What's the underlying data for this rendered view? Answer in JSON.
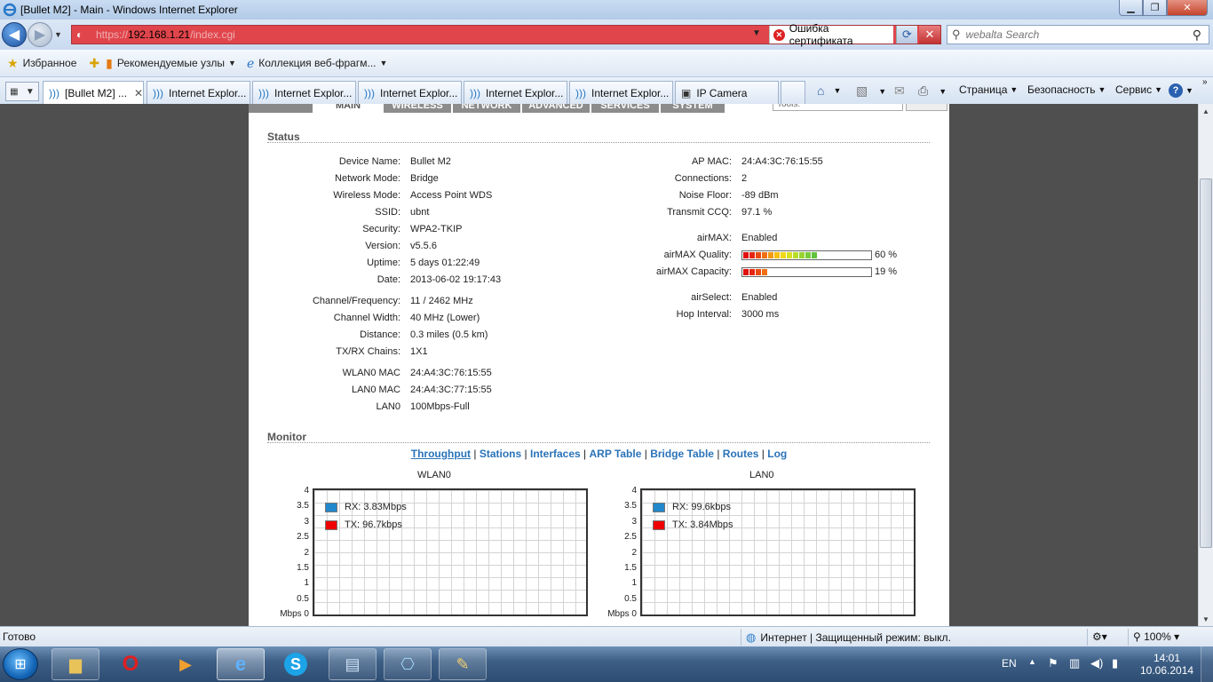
{
  "window": {
    "title": "[Bullet M2] - Main - Windows Internet Explorer"
  },
  "address": {
    "url_prefix": "https://",
    "url_host": "192.168.1.21",
    "url_path": "/index.cgi",
    "cert_error": "Ошибка сертификата"
  },
  "search": {
    "placeholder": "webalta Search"
  },
  "favorites": {
    "favorites_label": "Избранное",
    "suggested_label": "Рекомендуемые узлы",
    "gallery_label": "Коллекция веб-фрагм..."
  },
  "tabs": [
    {
      "label": "[Bullet M2] ..."
    },
    {
      "label": "Internet Explor..."
    },
    {
      "label": "Internet Explor..."
    },
    {
      "label": "Internet Explor..."
    },
    {
      "label": "Internet Explor..."
    },
    {
      "label": "Internet Explor..."
    },
    {
      "label": "IP Camera"
    }
  ],
  "commandbar": {
    "page": "Страница",
    "safety": "Безопасность",
    "tools": "Сервис"
  },
  "page": {
    "menu_tabs": [
      "MAIN",
      "WIRELESS",
      "NETWORK",
      "ADVANCED",
      "SERVICES",
      "SYSTEM"
    ],
    "tool_select": "Tools:",
    "status_title": "Status",
    "left": [
      {
        "label": "Device Name:",
        "value": "Bullet M2"
      },
      {
        "label": "Network Mode:",
        "value": "Bridge"
      },
      {
        "label": "Wireless Mode:",
        "value": "Access Point WDS"
      },
      {
        "label": "SSID:",
        "value": "ubnt"
      },
      {
        "label": "Security:",
        "value": "WPA2-TKIP"
      },
      {
        "label": "Version:",
        "value": "v5.5.6"
      },
      {
        "label": "Uptime:",
        "value": "5 days 01:22:49"
      },
      {
        "label": "Date:",
        "value": "2013-06-02 19:17:43"
      },
      {
        "label": "Channel/Frequency:",
        "value": "11 / 2462 MHz"
      },
      {
        "label": "Channel Width:",
        "value": "40 MHz (Lower)"
      },
      {
        "label": "Distance:",
        "value": "0.3 miles (0.5 km)"
      },
      {
        "label": "TX/RX Chains:",
        "value": "1X1"
      },
      {
        "label": "WLAN0 MAC",
        "value": "24:A4:3C:76:15:55"
      },
      {
        "label": "LAN0 MAC",
        "value": "24:A4:3C:77:15:55"
      },
      {
        "label": "LAN0",
        "value": "100Mbps-Full"
      }
    ],
    "right": [
      {
        "label": "AP MAC:",
        "value": "24:A4:3C:76:15:55"
      },
      {
        "label": "Connections:",
        "value": "2"
      },
      {
        "label": "Noise Floor:",
        "value": "-89 dBm"
      },
      {
        "label": "Transmit CCQ:",
        "value": "97.1 %"
      },
      {
        "label": "airMAX:",
        "value": "Enabled"
      },
      {
        "label": "airMAX Quality:",
        "value": "60 %",
        "level": 0.6
      },
      {
        "label": "airMAX Capacity:",
        "value": "19 %",
        "level": 0.19
      },
      {
        "label": "airSelect:",
        "value": "Enabled"
      },
      {
        "label": "Hop Interval:",
        "value": "3000 ms"
      }
    ],
    "monitor_title": "Monitor",
    "monitor_links": [
      "Throughput",
      "Stations",
      "Interfaces",
      "ARP Table",
      "Bridge Table",
      "Routes",
      "Log"
    ],
    "graphs": [
      {
        "title": "WLAN0",
        "rx": "RX: 3.83Mbps",
        "tx": "TX: 96.7kbps"
      },
      {
        "title": "LAN0",
        "rx": "RX: 99.6kbps",
        "tx": "TX: 3.84Mbps"
      }
    ],
    "y_ticks": [
      "4",
      "3.5",
      "3",
      "2.5",
      "2",
      "1.5",
      "1",
      "0.5",
      "Mbps 0"
    ],
    "colors": {
      "rx": "#2288cc",
      "tx": "#ee0000"
    }
  },
  "statusbar": {
    "status": "Готово",
    "zone": "Интернет | Защищенный режим: выкл.",
    "zoom": "100%"
  },
  "taskbar": {
    "lang": "EN",
    "time": "14:01",
    "date": "10.06.2014"
  }
}
